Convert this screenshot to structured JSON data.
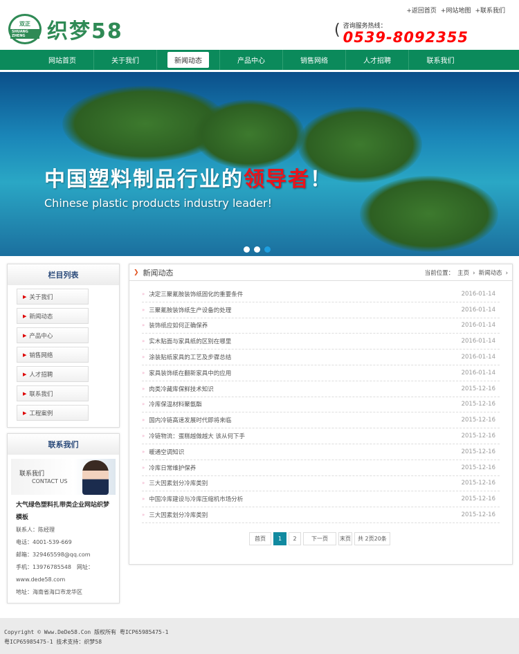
{
  "header": {
    "top_links": [
      "+返回首页",
      "+网站地图",
      "+联系我们"
    ],
    "logo_cn": "双正",
    "logo_en": "SHUANG ZHENG",
    "logo_text": "织梦58",
    "hotline_label": "咨询服务热线：",
    "hotline": "0539-8092355"
  },
  "nav": [
    "网站首页",
    "关于我们",
    "新闻动态",
    "产品中心",
    "销售网络",
    "人才招聘",
    "联系我们"
  ],
  "banner": {
    "title_white": "中国塑料制品行业的",
    "title_red": "领导者",
    "title_end": "！",
    "subtitle": "Chinese plastic products industry leader!",
    "active_slide": 3
  },
  "sidebar": {
    "title": "栏目列表",
    "items": [
      "关于我们",
      "新闻动态",
      "产品中心",
      "销售网络",
      "人才招聘",
      "联系我们",
      "工程案例"
    ]
  },
  "contact": {
    "title": "联系我们",
    "img_cn": "联系我们",
    "img_en": "CONTACT US",
    "company": "大气绿色塑料扎带类企业网站织梦模板",
    "lines": [
      "联系人：陈经理",
      "电话：4001-539-669",
      "邮箱：329465598@qq.com",
      "手机：13976785548　网址：www.dede58.com",
      "地址：海南省海口市龙华区"
    ]
  },
  "main": {
    "title": "新闻动态",
    "crumb_label": "当前位置：",
    "crumb": [
      "主页",
      "新闻动态"
    ],
    "news": [
      {
        "t": "决定三聚氰胺装饰纸固化的重要条件",
        "d": "2016-01-14"
      },
      {
        "t": "三聚氰胺装饰纸生产设备的处理",
        "d": "2016-01-14"
      },
      {
        "t": "装饰纸应如何正确保养",
        "d": "2016-01-14"
      },
      {
        "t": "实木贴面与家具纸的区别在哪里",
        "d": "2016-01-14"
      },
      {
        "t": "涂装贴纸家具的工艺及步骤总结",
        "d": "2016-01-14"
      },
      {
        "t": "家具装饰纸在翻新家具中的应用",
        "d": "2016-01-14"
      },
      {
        "t": "肉类冷藏库保鲜技术知识",
        "d": "2015-12-16"
      },
      {
        "t": "冷库保温材料聚氨酯",
        "d": "2015-12-16"
      },
      {
        "t": "国内冷链高速发展时代即将来临",
        "d": "2015-12-16"
      },
      {
        "t": "冷链物流：蛋糕越做越大 该从何下手",
        "d": "2015-12-16"
      },
      {
        "t": "暖通空调知识",
        "d": "2015-12-16"
      },
      {
        "t": "冷库日常维护保养",
        "d": "2015-12-16"
      },
      {
        "t": "三大因素划分冷库类别",
        "d": "2015-12-16"
      },
      {
        "t": "中国冷库建设与冷库压缩机市场分析",
        "d": "2015-12-16"
      },
      {
        "t": "三大因素划分冷库类别",
        "d": "2015-12-16"
      }
    ],
    "pager": {
      "first": "首页",
      "p1": "1",
      "p2": "2",
      "next": "下一页",
      "last": "末页",
      "total": "共 2页20条"
    }
  },
  "footer": {
    "line1": "Copyright © Www.DeDe58.Con 版权所有 粤ICP65985475-1",
    "line2": "粤ICP65985475-1 技术支持：织梦58"
  }
}
